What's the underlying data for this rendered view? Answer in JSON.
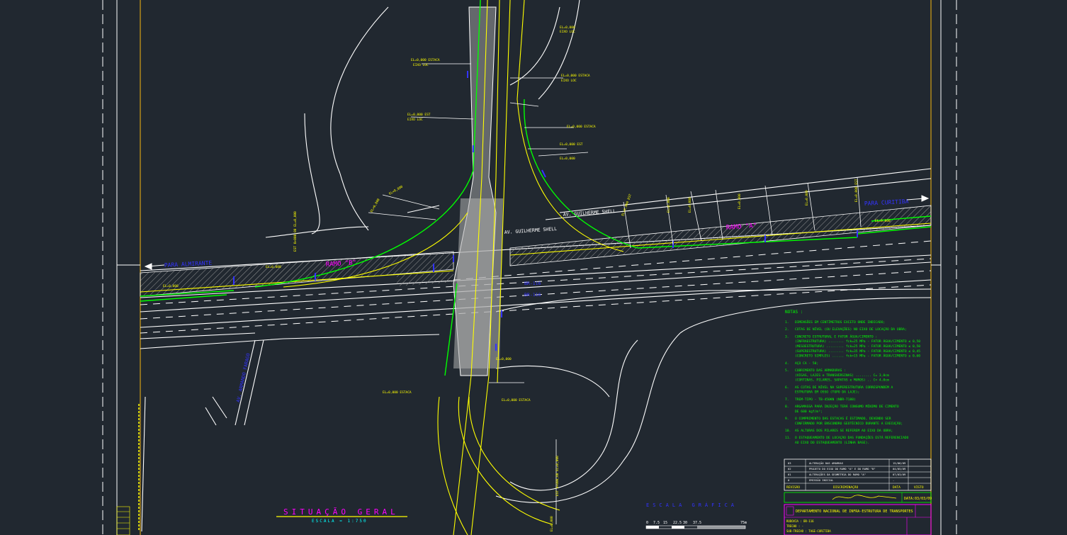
{
  "colors": {
    "background": "#212830",
    "white": "#ffffff",
    "yellow": "#ffff00",
    "green": "#00ff00",
    "blue": "#3333ff",
    "magenta": "#ff00ff",
    "gray": "#9a9a9a",
    "orange": "#d4a017",
    "cyan": "#00ffff"
  },
  "roads": {
    "left_direction": "PARA ALMIRANTE",
    "right_direction": "PARA CURITIBA",
    "ramo_a": "RAMO \"A\"",
    "ramo_b": "RAMO \"B\"",
    "street_upper": "AV. GUILHERME SHELL",
    "street_lower": "AV. GUILHERME SHELL",
    "street_left": "AV. ARMANDO FARAGO",
    "highway_1": "BR-116",
    "highway_2": "BR-116"
  },
  "notes": {
    "heading": "NOTAS :",
    "items": [
      {
        "n": "1.",
        "text": "DIMENSÕES EM CENTÍMETROS EXCETO ONDE INDICADO;"
      },
      {
        "n": "2.",
        "text": "COTAS DE NÍVEL (OU ELEVAÇÕES) NO EIXO DE LOCAÇÃO DA OBRA;"
      },
      {
        "n": "3.",
        "text": "CONCRETO ESTRUTURAL E FATOR ÁGUA/CIMENTO :"
      },
      {
        "n": "",
        "text": "(INFRAESTRUTURA) ........ fck=25 MPa - FATOR ÁGUA/CIMENTO ≤ 0,50"
      },
      {
        "n": "",
        "text": "(MESOESTRUTURA) ......... fck=25 MPa - FATOR ÁGUA/CIMENTO ≤ 0,50"
      },
      {
        "n": "",
        "text": "(SUPERESTRUTURA) ........ fck=35 MPa - FATOR ÁGUA/CIMENTO ≤ 0,45"
      },
      {
        "n": "",
        "text": "(CONCRETO SIMPLES) ...... fck=15 MPa - FATOR ÁGUA/CIMENTO ≤ 0,60"
      },
      {
        "n": "4.",
        "text": "AÇO CA - 50;"
      },
      {
        "n": "5.",
        "text": "COBRIMENTO DAS ARMADURAS :"
      },
      {
        "n": "",
        "text": "(VIGAS, LAJES e TRANSVERSINAS) ........ C= 3,0cm"
      },
      {
        "n": "",
        "text": "(CORTINAS, PILARES, SAPATAS e MUROS) .. C= 4,0cm"
      },
      {
        "n": "6.",
        "text": "AS COTAS DE NÍVEL NA SUPERESTRUTURA CORRESPONDEM A"
      },
      {
        "n": "",
        "text": "ESTRUTURA EM OSSO (TOPO DA LAJE);"
      },
      {
        "n": "7.",
        "text": "TREM-TIPO - TB-450KN (NBR-7188)"
      },
      {
        "n": "8.",
        "text": "ARGAMASSA PARA INJEÇÃO TERÁ CONSUMO MÍNIMO DE CIMENTO"
      },
      {
        "n": "",
        "text": "DE 600 kgf/m³;"
      },
      {
        "n": "9.",
        "text": "O COMPRIMENTO DAS ESTACAS É ESTIMADO, DEVENDO SER"
      },
      {
        "n": "",
        "text": "CONFIRMADO POR ENSCONDRO GEOTÉCNICO DURANTE A EXECUÇÃO;"
      },
      {
        "n": "10.",
        "text": "AS ALTURAS DOS PILARES SE REFEREM AO EIXO DA OBRA;"
      },
      {
        "n": "11.",
        "text": "O ESTAQUEAMENTO DE LOCAÇÃO DAS FUNDAÇÕES ESTÁ REFERENCIADO"
      },
      {
        "n": "",
        "text": "AO EIXO DO ESTAQUEAMENTO (LINHA BASE)."
      }
    ]
  },
  "revisions": {
    "rows": [
      {
        "rev": "03",
        "desc": "ALTERAÇÃO DAS AMARRAS",
        "date": "15/06/09",
        "visto": ""
      },
      {
        "rev": "02",
        "desc": "PROJETO DO EIXO DO RAMO \"A\" E DO RAMO \"B\"",
        "date": "04/05/09",
        "visto": ""
      },
      {
        "n": "",
        "rev": "01",
        "desc": "ALTERAÇÕES DA GEOMETRIA DO RAMO \"A\"",
        "date": "07/03/09",
        "visto": ""
      },
      {
        "rev": "0",
        "desc": "EMISSÃO INICIAL",
        "date": "-",
        "visto": ""
      }
    ],
    "header": {
      "rev": "REVISÃO",
      "desc": "DISCRIMINAÇÃO",
      "date": "DATA",
      "visto": "VISTO"
    }
  },
  "title_block": {
    "date": "DATA:03/03/09",
    "agency": "DEPARTAMENTO NACIONAL DE INFRA-ESTRUTURA DE TRANSPORTES",
    "rodovia": "RODOVIA : BR-116",
    "trecho": "TRECHO : -",
    "sub_trecho": "SUB-TRECHO : TAGE-CURITIBA"
  },
  "situacao": {
    "title": "SITUAÇÃO GERAL",
    "scale": "ESCALA = 1:750"
  },
  "graphic_scale": {
    "title": "ESCALA GRÁFICA",
    "ticks": [
      "0",
      "7.5",
      "15",
      "22.5",
      "30",
      "37.5",
      "75m"
    ]
  }
}
